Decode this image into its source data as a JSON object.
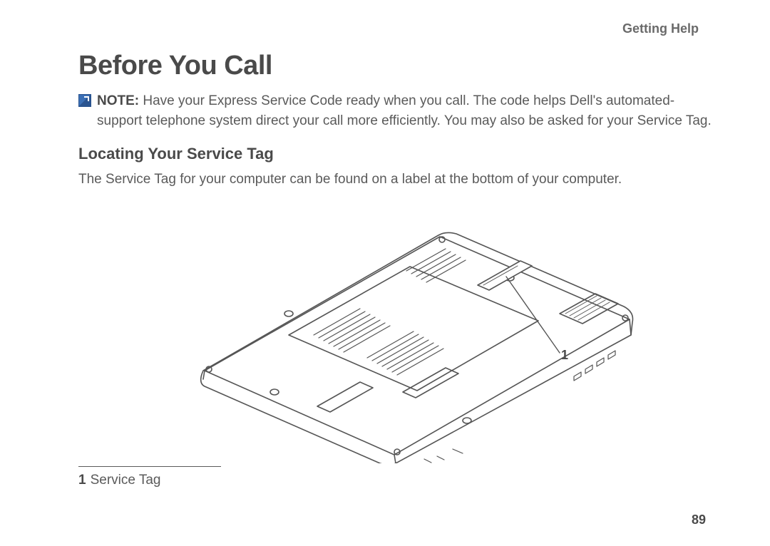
{
  "running_head": "Getting Help",
  "heading": "Before You Call",
  "note": {
    "label": "NOTE:",
    "body": "Have your Express Service Code ready when you call. The code helps Dell's automated-support telephone system direct your call more efficiently. You may also be asked for your Service Tag."
  },
  "subheading": "Locating Your Service Tag",
  "subtext": "The Service Tag for your computer can be found on a label at the bottom of your computer.",
  "callouts": {
    "c1": "1"
  },
  "legend": {
    "num": "1",
    "label": "Service Tag"
  },
  "page_number": "89"
}
